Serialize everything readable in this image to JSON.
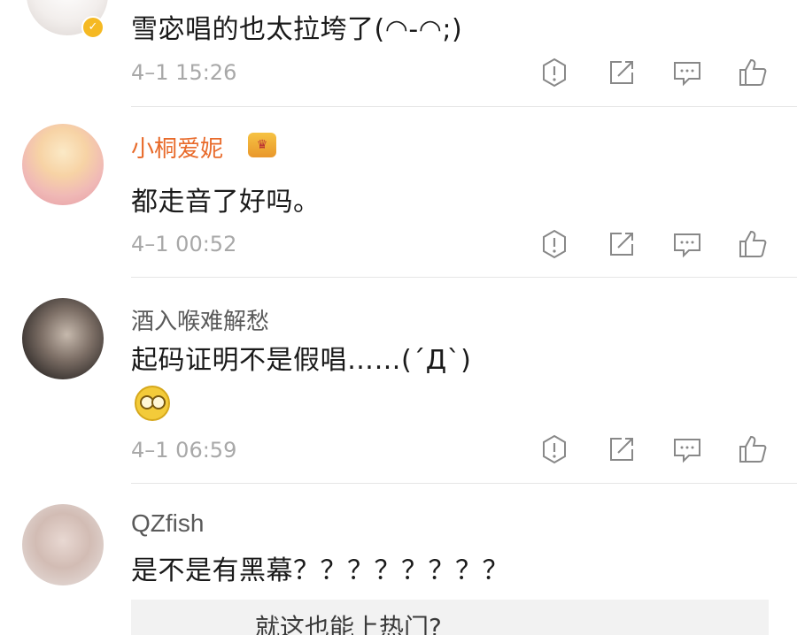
{
  "comments": [
    {
      "username": "",
      "text": "雪宓唱的也太拉垮了(◠-◠;)",
      "time": "4–1 15:26"
    },
    {
      "username": "小桐爱妮",
      "text": "都走音了好吗。",
      "time": "4–1 00:52"
    },
    {
      "username": "酒入喉难解愁",
      "text": "起码证明不是假唱……(´Д`)",
      "time": "4–1 06:59"
    },
    {
      "username": "QZfish",
      "text": "是不是有黑幕？？？？？？？？",
      "time": ""
    }
  ],
  "reply_preview": "就这也能上热门?",
  "icons": [
    "report-icon",
    "repost-icon",
    "comment-icon",
    "like-icon"
  ]
}
